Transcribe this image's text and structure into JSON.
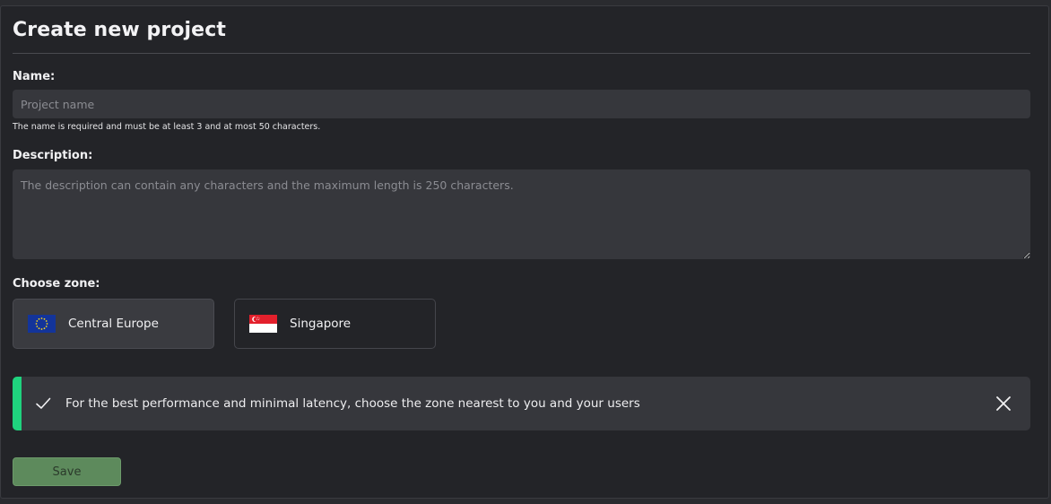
{
  "form": {
    "title": "Create new project",
    "name": {
      "label": "Name:",
      "value": "",
      "placeholder": "Project name",
      "hint": "The name is required and must be at least 3 and at most 50 characters."
    },
    "description": {
      "label": "Description:",
      "value": "",
      "placeholder": "The description can contain any characters and the maximum length is 250 characters."
    },
    "zone": {
      "label": "Choose zone:",
      "options": [
        {
          "label": "Central Europe",
          "icon": "eu-flag-icon",
          "selected": true
        },
        {
          "label": "Singapore",
          "icon": "singapore-flag-icon",
          "selected": false
        }
      ]
    },
    "alert": {
      "icon": "check-icon",
      "text": "For the best performance and minimal latency, choose the zone nearest to you and your users",
      "close_icon": "close-icon",
      "accent_color": "#1fd37e"
    },
    "save_label": "Save"
  }
}
